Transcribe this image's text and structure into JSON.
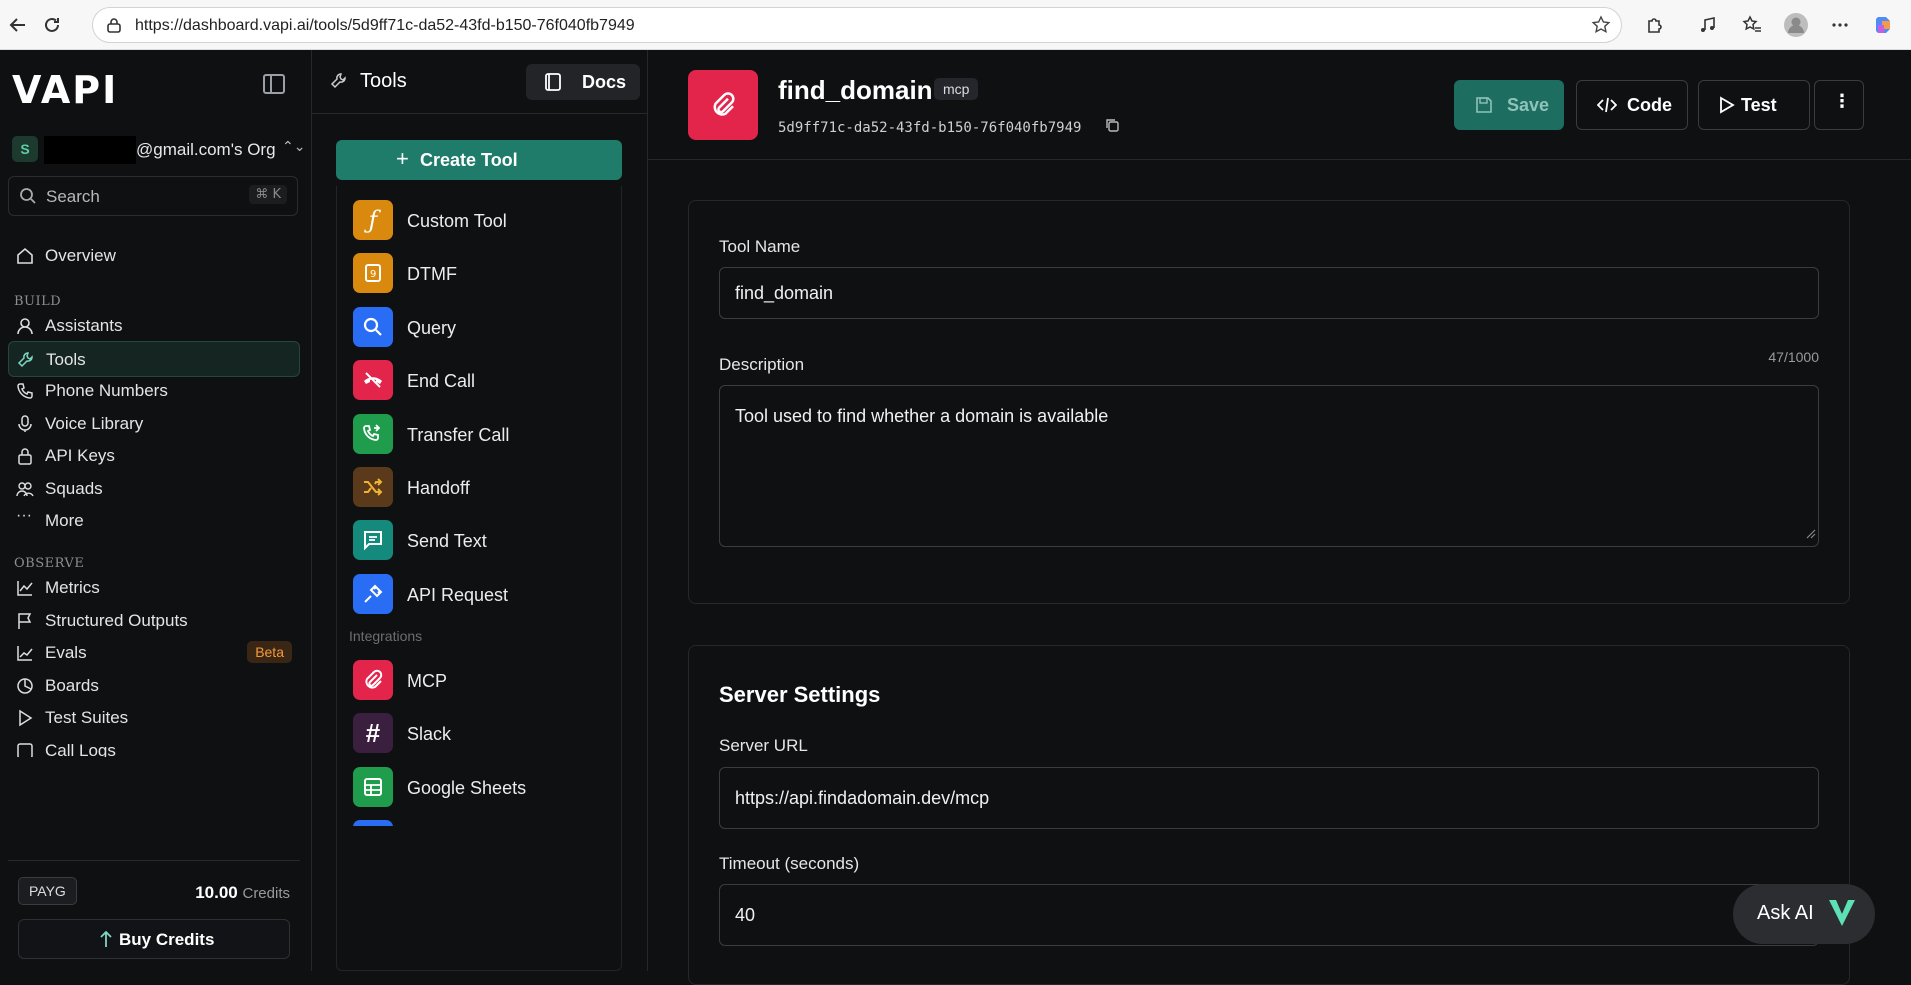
{
  "browser": {
    "url": "https://dashboard.vapi.ai/tools/5d9ff71c-da52-43fd-b150-76f040fb7949"
  },
  "sidebar": {
    "logo": "VAPI",
    "org_initial": "S",
    "org_name": "@gmail.com's Org",
    "search_placeholder": "Search",
    "search_shortcut": "⌘ K",
    "overview": "Overview",
    "build_label": "BUILD",
    "build_items": [
      "Assistants",
      "Tools",
      "Phone Numbers",
      "Voice Library",
      "API Keys",
      "Squads",
      "More"
    ],
    "observe_label": "OBSERVE",
    "observe_items": [
      "Metrics",
      "Structured Outputs",
      "Evals",
      "Boards",
      "Test Suites",
      "Call Logs"
    ],
    "evals_badge": "Beta",
    "plan": "PAYG",
    "credits_value": "10.00",
    "credits_unit": "Credits",
    "buy_label": "Buy Credits"
  },
  "tools_panel": {
    "title": "Tools",
    "docs_label": "Docs",
    "create_label": "Create Tool",
    "tools": [
      "Custom Tool",
      "DTMF",
      "Query",
      "End Call",
      "Transfer Call",
      "Handoff",
      "Send Text",
      "API Request"
    ],
    "integrations_label": "Integrations",
    "integrations": [
      "MCP",
      "Slack",
      "Google Sheets"
    ]
  },
  "main": {
    "tool_name": "find_domain",
    "badge": "mcp",
    "tool_id": "5d9ff71c-da52-43fd-b150-76f040fb7949",
    "save_label": "Save",
    "code_label": "Code",
    "test_label": "Test",
    "more_label": "⋮",
    "tool_name_label": "Tool Name",
    "tool_name_value": "find_domain",
    "description_label": "Description",
    "description_count": "47/1000",
    "description_value": "Tool used to find whether a domain is available",
    "server_settings_title": "Server Settings",
    "server_url_label": "Server URL",
    "server_url_value": "https://api.findadomain.dev/mcp",
    "timeout_label": "Timeout (seconds)",
    "timeout_value": "40",
    "ask_ai_label": "Ask AI"
  },
  "colors": {
    "accent": "#1f7b6a",
    "brand_red": "#e3244b"
  }
}
